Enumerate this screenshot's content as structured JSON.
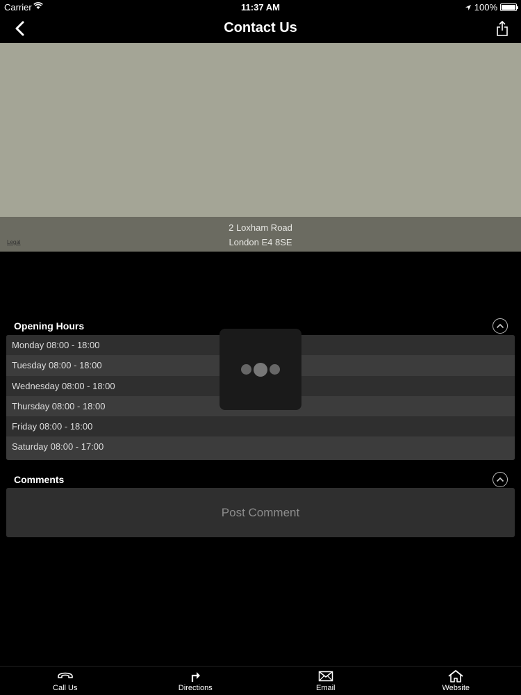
{
  "status": {
    "carrier": "Carrier",
    "time": "11:37 AM",
    "battery": "100%"
  },
  "nav": {
    "title": "Contact Us"
  },
  "map": {
    "address_line1": "2 Loxham Road",
    "address_line2": "London E4 8SE",
    "legal": "Legal"
  },
  "opening_hours": {
    "title": "Opening Hours",
    "rows": [
      "Monday 08:00 - 18:00",
      "Tuesday 08:00 - 18:00",
      "Wednesday 08:00 - 18:00",
      "Thursday 08:00 - 18:00",
      "Friday 08:00 - 18:00",
      "Saturday 08:00 - 17:00"
    ]
  },
  "comments": {
    "title": "Comments",
    "post_label": "Post Comment"
  },
  "tabs": [
    {
      "label": "Call Us",
      "icon": "phone-icon"
    },
    {
      "label": "Directions",
      "icon": "directions-icon"
    },
    {
      "label": "Email",
      "icon": "email-icon"
    },
    {
      "label": "Website",
      "icon": "home-icon"
    }
  ],
  "colors": {
    "background": "#000000",
    "map": "#a4a596",
    "row_dark": "#2f2f2f",
    "row_light": "#3c3c3c"
  }
}
